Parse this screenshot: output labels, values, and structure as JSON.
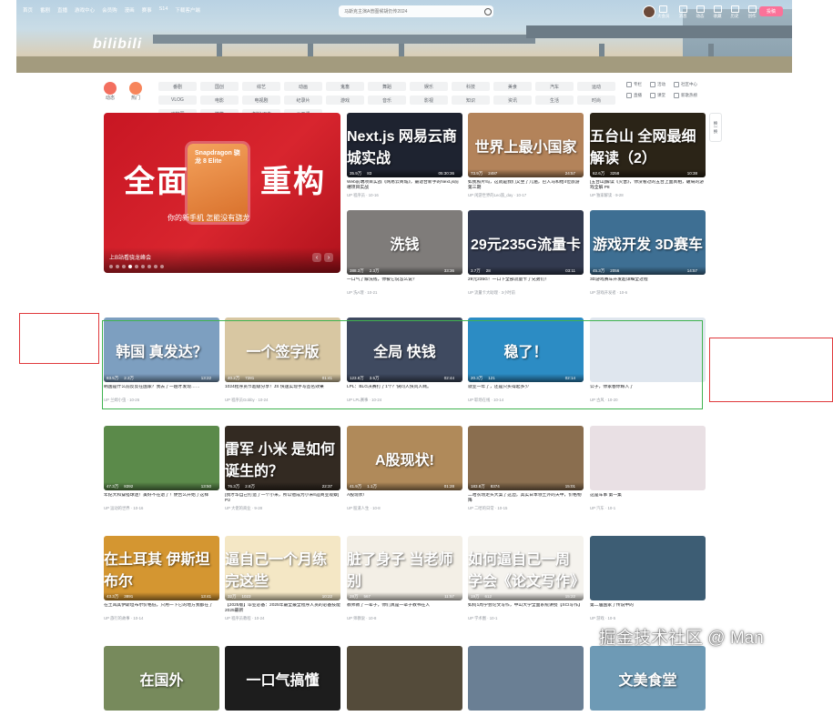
{
  "header": {
    "logo": "bilibili",
    "nav": [
      "首页",
      "番剧",
      "直播",
      "游戏中心",
      "会员购",
      "漫画",
      "赛事",
      "S14",
      "下载客户端"
    ],
    "search_placeholder": "马斯克主演A普图候胡仍传2024",
    "tools": [
      "大会员",
      "消息",
      "动态",
      "收藏",
      "历史",
      "创作"
    ],
    "upload": "投稿",
    "colors": {
      "accent": "#fb7299"
    }
  },
  "channels": {
    "icons": [
      {
        "label": "动态",
        "color": "#f36f5f"
      },
      {
        "label": "热门",
        "color": "#f7855b"
      }
    ],
    "tags": [
      "番剧",
      "国创",
      "综艺",
      "动画",
      "鬼畜",
      "舞蹈",
      "娱乐",
      "科技",
      "美食",
      "汽车",
      "运动",
      "VLOG",
      "电影",
      "电视剧",
      "纪录片",
      "游戏",
      "音乐",
      "影视",
      "知识",
      "资讯",
      "生活",
      "时尚",
      "动物圈",
      "搞笑",
      "虚拟UP主",
      "公开课"
    ],
    "side_links": [
      "专栏",
      "活动",
      "社区中心",
      "直播",
      "课堂",
      "新歌热榜"
    ]
  },
  "carousel": {
    "headline": "全面",
    "headline2": "重构",
    "chip_label": "Snapdragon 骁龙 8 Elite",
    "subline": "你的新手机 怎能没有骁龙",
    "caption": "上B站看骁龙峰会",
    "slide_count": 9,
    "active_slide": 3
  },
  "refresh_label": "换一换",
  "cards": [
    {
      "id": "c1",
      "cap": "Next.js 网易云商城实战",
      "bg": "#1e2330",
      "views": "35.9万",
      "comments": "83",
      "duration": "05:30:36",
      "title": "Web前端项目实战《网易云商城》，最适合新手的Next.js前端项目实战",
      "author": "UP 程序员 · 10-16"
    },
    {
      "id": "c2",
      "cap": "世界上最小国家",
      "bg": "#b3835a",
      "views": "73.9万",
      "comments": "2497",
      "duration": "24:57",
      "title": "如我照片吗，这就是我们又坐了几遍，巴人马和给4位旅游第三期",
      "author": "UP 闲游世界的Leo旅_day · 10-17"
    },
    {
      "id": "c3",
      "cap": "五台山 全网最细解读（2）",
      "bg": "#2b2417",
      "views": "62.6万",
      "comments": "3258",
      "duration": "10:38",
      "title": "[五台山]解读《灭晋》，你没看过的五台上面真相，破局的游戏全解 P8",
      "author": "UP 独家解读 · 9-28"
    },
    {
      "id": "c4",
      "cap": "洗钱",
      "bg": "#7f7c7a",
      "views": "388.3万",
      "comments": "2.3万",
      "duration": "33:36",
      "title": "一口气了解洗钱，你被它说怎么说？",
      "author": "UP 洗A理 · 10-21"
    },
    {
      "id": "c5",
      "cap": "29元235G流量卡",
      "bg": "#323a4f",
      "views": "3.7万",
      "comments": "28",
      "duration": "03:11",
      "title": "29元235G！一口下全部流量卡了兄弟们！",
      "author": "UP 流量卡大助理 · 3小时前"
    },
    {
      "id": "c6",
      "cap": "游戏开发 3D赛车",
      "bg": "#3e6f93",
      "views": "45.3万",
      "comments": "2056",
      "duration": "14:57",
      "title": "3D游戏赛车开发超详细全过程",
      "author": "UP 游戏开发者 · 10-6"
    },
    {
      "id": "c7",
      "cap": "韩国 真发达？",
      "bg": "#7d9fc0",
      "views": "83.5万",
      "comments": "2.3万",
      "duration": "13:22",
      "title": "韩国是什么前反反在国家？我去了一趟才发现……",
      "author": "UP 兰姆小虫 · 10-26"
    },
    {
      "id": "c8",
      "cap": "一个签字版",
      "bg": "#d8c7a2",
      "views": "40.2万",
      "comments": "7281",
      "duration": "01:41",
      "title": "1024程序员节超级分享！JS 快速实现手写签名效果",
      "author": "UP 程序员Gobby · 10-24"
    },
    {
      "id": "c9",
      "cap": "全局 快钱",
      "bg": "#3f4a60",
      "views": "123.8万",
      "comments": "3.5万",
      "duration": "02:44",
      "title": "LPL：BLG决赛打了1个？快问人快问人啊。",
      "author": "UP LPL赛事 · 10-24"
    },
    {
      "id": "c10",
      "cap": "稳了！",
      "bg": "#2c8cc4",
      "views": "20.3万",
      "comments": "121",
      "duration": "02:14",
      "title": "就业一年了，还是只买得起多少",
      "author": "UP 职场在线 · 10-14"
    },
    {
      "id": "c11",
      "cap": "",
      "bg": "#dfe6ee",
      "views": "",
      "comments": "",
      "duration": "",
      "title": "公子，你家春你嫁入了",
      "author": "UP 古风 · 10-20"
    },
    {
      "id": "c12",
      "cap": "",
      "bg": "#5b8a4a",
      "views": "47.3万",
      "comments": "8392",
      "duration": "13:50",
      "title": "年纪大和穿搭球迷！美好不在退了！便告么开始了这样",
      "author": "UP 运动的世界 · 10-16"
    },
    {
      "id": "c13",
      "cap": "雷军 小米 是如何诞生的？",
      "bg": "#332a22",
      "views": "76.3万",
      "comments": "2.8万",
      "duration": "22:37",
      "title": "[我才华自己打造了一个小米，所以他成为小米吗][商业观察] P2",
      "author": "UP 大佬的商业 · 9-28"
    },
    {
      "id": "c14",
      "cap": "A股现状!",
      "bg": "#b08a5a",
      "views": "41.9万",
      "comments": "1.1万",
      "duration": "01:28",
      "title": "A股现状!",
      "author": "UP 股道人生 · 10-8"
    },
    {
      "id": "c15",
      "cap": "",
      "bg": "#8a6e4f",
      "views": "183.8万",
      "comments": "8374",
      "duration": "15:01",
      "title": "二哈农场走头大案了这边，其实日本领土外的天中，价格物降",
      "author": "UP 二哈的日常 · 10-15"
    },
    {
      "id": "c16",
      "cap": "",
      "bg": "#e9e0e4",
      "views": "",
      "comments": "",
      "duration": "",
      "title": "这是车事 第一集",
      "author": "UP 汽车 · 10-1"
    },
    {
      "id": "c17",
      "cap": "在土耳其 伊斯坦布尔",
      "bg": "#d49631",
      "views": "43.3万",
      "comments": "3891",
      "duration": "13:41",
      "title": "在土耳其伊斯坦布尔价格低，只用一下它的地方我都在了",
      "author": "UP 旅行的故事 · 10-14"
    },
    {
      "id": "c18",
      "cap": "逼自己一个月练完这些",
      "bg": "#f4e7c5",
      "views": "32万",
      "comments": "1023",
      "duration": "10:22",
      "title": "【2025版】毕业必备：2025年最全最全程序人员的必备技能 2025最新",
      "author": "UP 程序员教程 · 10-24"
    },
    {
      "id": "c19",
      "cap": "脏了身子 当老师别",
      "bg": "#f3efe6",
      "views": "28万",
      "comments": "567",
      "duration": "11:57",
      "title": "教师教了一辈子，你们真是一辈子教书在人",
      "author": "UP 师教说 · 10-8"
    },
    {
      "id": "c20",
      "cap": "如何逼自己一周学会《论文写作》",
      "bg": "#f5f3ee",
      "views": "19万",
      "comments": "612",
      "duration": "15:22",
      "title": "如何1周学会论文写作，中山大学全面系统讲授【SCI写作】",
      "author": "UP 学术圈 · 10-1"
    },
    {
      "id": "c21",
      "cap": "",
      "bg": "#3d5d74",
      "views": "",
      "comments": "",
      "duration": "",
      "title": "第二届国家了传说中的",
      "author": "UP 游戏 · 10-5"
    },
    {
      "id": "c22",
      "cap": "在国外",
      "bg": "#778a5c",
      "views": "",
      "comments": "",
      "duration": "",
      "title": "",
      "author": ""
    },
    {
      "id": "c23",
      "cap": "一口气搞懂",
      "bg": "#1d1d1d",
      "views": "",
      "comments": "",
      "duration": "",
      "title": "",
      "author": ""
    },
    {
      "id": "c24",
      "cap": "",
      "bg": "#544b3a",
      "views": "",
      "comments": "",
      "duration": "",
      "title": "",
      "author": ""
    },
    {
      "id": "c25",
      "cap": "",
      "bg": "#6a7f94",
      "views": "",
      "comments": "",
      "duration": "",
      "title": "",
      "author": ""
    },
    {
      "id": "c26",
      "cap": "文美食堂",
      "bg": "#6e9ab5",
      "views": "",
      "comments": "",
      "duration": "",
      "title": "",
      "author": ""
    }
  ],
  "watermark": "掘金技术社区 @ Man"
}
